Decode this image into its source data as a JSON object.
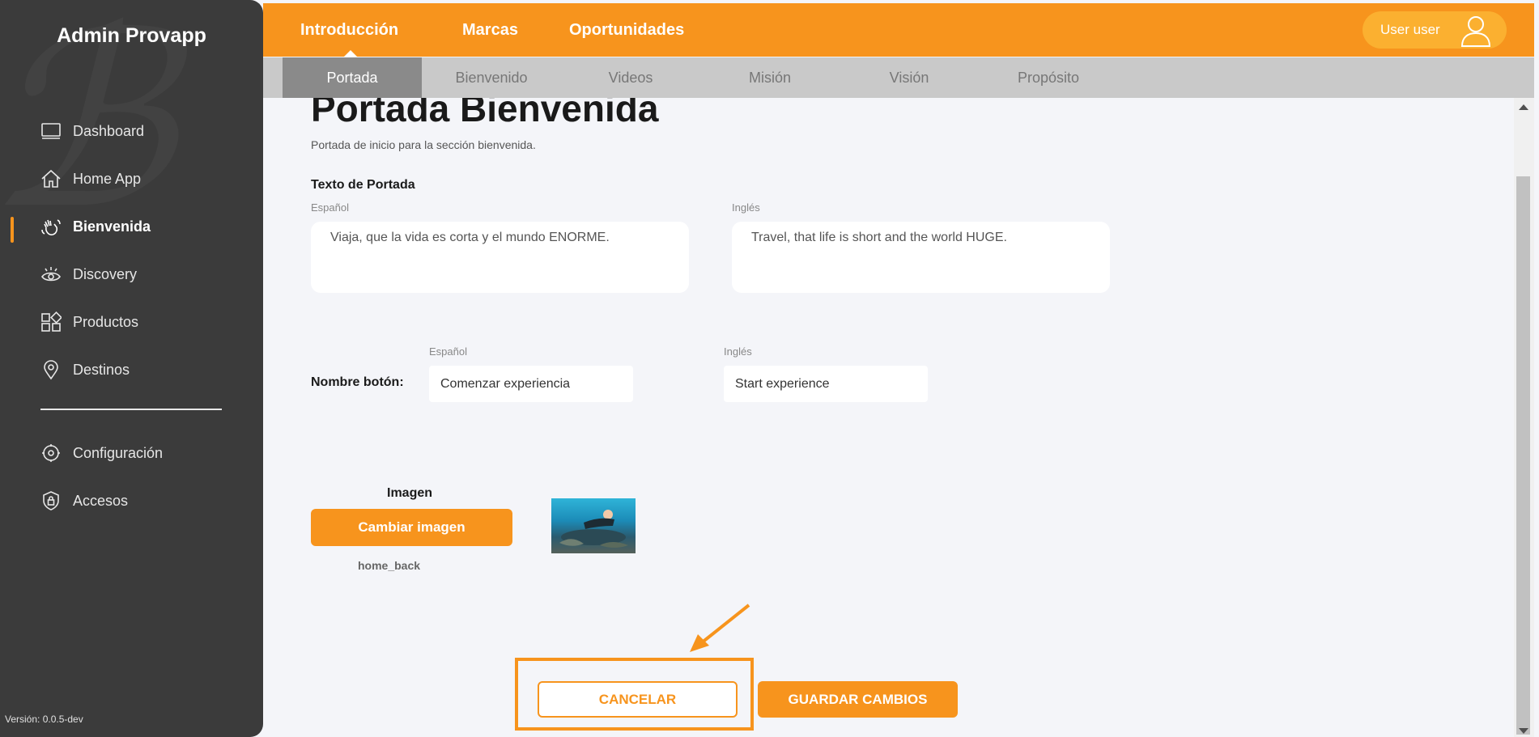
{
  "app": {
    "brand": "Admin Provapp",
    "version": "Versión: 0.0.5-dev"
  },
  "sidebar": {
    "items": [
      {
        "label": "Dashboard",
        "icon": "monitor-icon"
      },
      {
        "label": "Home App",
        "icon": "home-icon"
      },
      {
        "label": "Bienvenida",
        "icon": "waving-hand-icon",
        "active": true
      },
      {
        "label": "Discovery",
        "icon": "eye-icon"
      },
      {
        "label": "Productos",
        "icon": "grid-icon"
      },
      {
        "label": "Destinos",
        "icon": "location-pin-icon"
      },
      {
        "label": "Configuración",
        "icon": "gear-icon"
      },
      {
        "label": "Accesos",
        "icon": "shield-lock-icon"
      }
    ]
  },
  "header": {
    "tabs": [
      "Introducción",
      "Marcas",
      "Oportunidades"
    ],
    "active_tab": "Introducción",
    "user": "User user"
  },
  "subtabs": {
    "items": [
      "Portada",
      "Bienvenido",
      "Videos",
      "Misión",
      "Visión",
      "Propósito"
    ],
    "active": "Portada"
  },
  "page": {
    "title": "Portada Bienvenida",
    "subtitle": "Portada de inicio para la sección bienvenida."
  },
  "cover_text": {
    "label": "Texto de Portada",
    "es_label": "Español",
    "en_label": "Inglés",
    "es_value": "Viaja, que la vida es corta y el mundo ENORME.",
    "en_value": "Travel, that life is short and the world HUGE."
  },
  "button_name": {
    "label": "Nombre botón:",
    "es_label": "Español",
    "en_label": "Inglés",
    "es_value": "Comenzar experiencia",
    "en_value": "Start experience"
  },
  "image": {
    "label": "Imagen",
    "change_button": "Cambiar imagen",
    "file_name": "home_back"
  },
  "actions": {
    "cancel": "CANCELAR",
    "save": "GUARDAR CAMBIOS"
  },
  "colors": {
    "accent": "#f7941d",
    "sidebar": "#3b3b3b",
    "subtab_bar": "#c9c9c9"
  }
}
